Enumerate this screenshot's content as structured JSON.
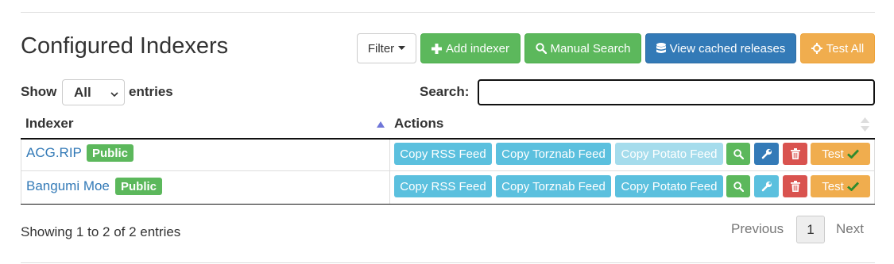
{
  "page": {
    "title": "Configured Indexers"
  },
  "toolbar": {
    "filter_label": "Filter",
    "add_label": "Add indexer",
    "manual_label": "Manual Search",
    "cached_label": "View cached releases",
    "testall_label": "Test All"
  },
  "controls": {
    "show_label": "Show",
    "length_value": "All",
    "entries_label": "entries",
    "search_label": "Search:",
    "search_value": ""
  },
  "table": {
    "headers": [
      "Indexer",
      "Actions"
    ],
    "rows": [
      {
        "name": "ACG.RIP",
        "badge": "Public",
        "rss": "Copy RSS Feed",
        "torznab": "Copy Torznab Feed",
        "potato": "Copy Potato Feed",
        "test": "Test"
      },
      {
        "name": "Bangumi Moe",
        "badge": "Public",
        "rss": "Copy RSS Feed",
        "torznab": "Copy Torznab Feed",
        "potato": "Copy Potato Feed",
        "test": "Test"
      }
    ]
  },
  "footer": {
    "info": "Showing 1 to 2 of 2 entries",
    "previous": "Previous",
    "page": "1",
    "next": "Next"
  },
  "icons": {
    "filter": "caret-down-icon",
    "add": "plus-icon",
    "manual": "search-icon",
    "cached": "database-icon",
    "testall": "crosshair-icon",
    "row_search": "search-icon",
    "row_config": "wrench-icon",
    "row_delete": "trash-icon",
    "row_test": "check-icon"
  },
  "colors": {
    "success": "#5cb85c",
    "primary": "#337ab7",
    "info": "#5bc0de",
    "danger": "#d9534f",
    "warning": "#f0ad4e",
    "link": "#337ab7"
  }
}
